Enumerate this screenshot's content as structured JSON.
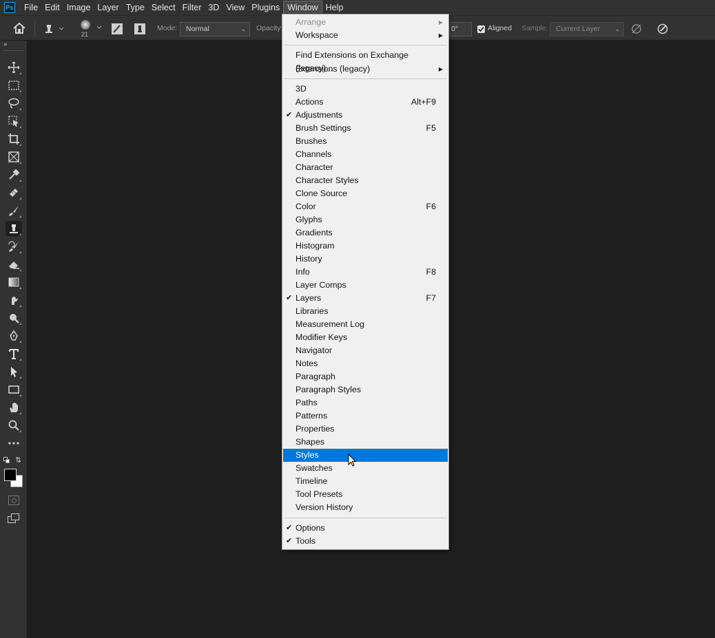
{
  "app": {
    "logo": "Ps"
  },
  "menubar": [
    "File",
    "Edit",
    "Image",
    "Layer",
    "Type",
    "Select",
    "Filter",
    "3D",
    "View",
    "Plugins",
    "Window",
    "Help"
  ],
  "options": {
    "brush_size": "21",
    "mode_label": "Mode:",
    "mode_value": "Normal",
    "opacity_label": "Opacity:",
    "angle_value": "0°",
    "aligned_label": "Aligned",
    "sample_label": "Sample:",
    "sample_value": "Current Layer"
  },
  "window_menu": {
    "top": [
      {
        "label": "Arrange",
        "disabled": true,
        "submenu": true
      },
      {
        "label": "Workspace",
        "submenu": true
      }
    ],
    "ext": [
      {
        "label": "Find Extensions on Exchange (legacy)..."
      },
      {
        "label": "Extensions (legacy)",
        "submenu": true
      }
    ],
    "panels": [
      {
        "label": "3D"
      },
      {
        "label": "Actions",
        "shortcut": "Alt+F9"
      },
      {
        "label": "Adjustments",
        "checked": true
      },
      {
        "label": "Brush Settings",
        "shortcut": "F5"
      },
      {
        "label": "Brushes"
      },
      {
        "label": "Channels"
      },
      {
        "label": "Character"
      },
      {
        "label": "Character Styles"
      },
      {
        "label": "Clone Source"
      },
      {
        "label": "Color",
        "shortcut": "F6"
      },
      {
        "label": "Glyphs"
      },
      {
        "label": "Gradients"
      },
      {
        "label": "Histogram"
      },
      {
        "label": "History"
      },
      {
        "label": "Info",
        "shortcut": "F8"
      },
      {
        "label": "Layer Comps"
      },
      {
        "label": "Layers",
        "checked": true,
        "shortcut": "F7"
      },
      {
        "label": "Libraries"
      },
      {
        "label": "Measurement Log"
      },
      {
        "label": "Modifier Keys"
      },
      {
        "label": "Navigator"
      },
      {
        "label": "Notes"
      },
      {
        "label": "Paragraph"
      },
      {
        "label": "Paragraph Styles"
      },
      {
        "label": "Paths"
      },
      {
        "label": "Patterns"
      },
      {
        "label": "Properties"
      },
      {
        "label": "Shapes"
      },
      {
        "label": "Styles",
        "highlighted": true
      },
      {
        "label": "Swatches"
      },
      {
        "label": "Timeline"
      },
      {
        "label": "Tool Presets"
      },
      {
        "label": "Version History"
      }
    ],
    "bottom": [
      {
        "label": "Options",
        "checked": true
      },
      {
        "label": "Tools",
        "checked": true
      }
    ]
  },
  "tools": [
    "move-tool-icon",
    "marquee-tool-icon",
    "lasso-tool-icon",
    "object-select-tool-icon",
    "crop-tool-icon",
    "frame-tool-icon",
    "eyedropper-tool-icon",
    "healing-brush-tool-icon",
    "brush-tool-icon",
    "clone-stamp-tool-icon",
    "history-brush-tool-icon",
    "eraser-tool-icon",
    "gradient-tool-icon",
    "smudge-tool-icon",
    "dodge-tool-icon",
    "pen-tool-icon",
    "type-tool-icon",
    "path-select-tool-icon",
    "rectangle-tool-icon",
    "hand-tool-icon",
    "zoom-tool-icon",
    "more-tools-icon"
  ]
}
